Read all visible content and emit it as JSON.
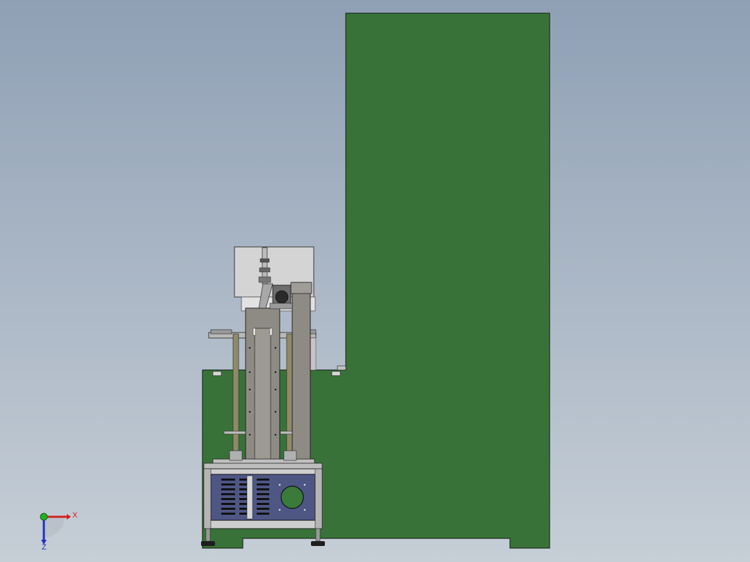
{
  "viewport": {
    "background_top": "#8fa0b5",
    "background_bottom": "#c6ced6"
  },
  "model": {
    "frame_color": "#387238",
    "frame_edge": "#1f2f1f",
    "steel_color": "#8e8b85",
    "light_steel": "#c8c8c8",
    "panel_color": "#4e5684",
    "rod_color": "#8f8a68"
  },
  "triad": {
    "x_label": "X",
    "z_label": "Z",
    "x_color": "#d02020",
    "y_color": "#22b022",
    "z_color": "#2030c0"
  }
}
